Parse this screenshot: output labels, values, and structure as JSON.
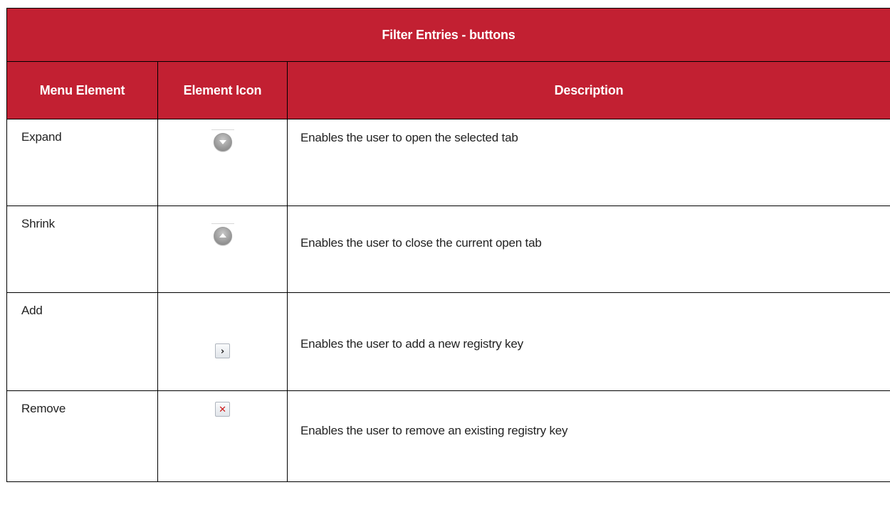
{
  "table": {
    "title": "Filter Entries - buttons",
    "headers": {
      "menu_element": "Menu Element",
      "element_icon": "Element Icon",
      "description": "Description"
    },
    "rows": [
      {
        "element": "Expand",
        "icon": "expand-icon",
        "description": "Enables the user to open the selected tab"
      },
      {
        "element": "Shrink",
        "icon": "shrink-icon",
        "description": "Enables the user to close the current open tab"
      },
      {
        "element": "Add",
        "icon": "add-arrow-icon",
        "description": "Enables the user to add a new registry key"
      },
      {
        "element": "Remove",
        "icon": "remove-x-icon",
        "description": "Enables the user to remove an existing registry key"
      }
    ]
  },
  "colors": {
    "header_bg": "#c22032",
    "header_text": "#ffffff",
    "border": "#000000",
    "body_text": "#222222"
  }
}
